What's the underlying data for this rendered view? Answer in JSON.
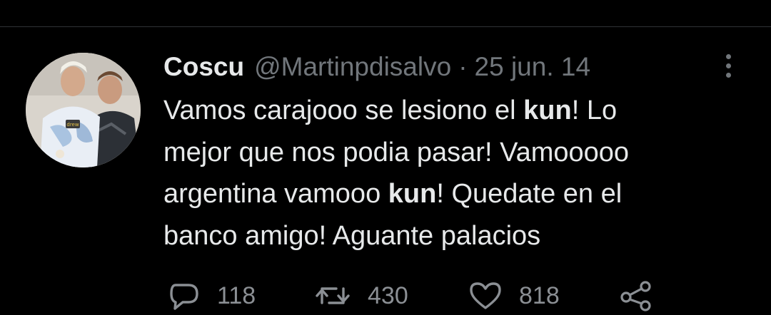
{
  "tweet": {
    "author_name": "Coscu",
    "handle": "@Martinpdisalvo",
    "separator": "·",
    "date": "25 jun. 14",
    "text_lines": [
      [
        {
          "t": "Vamos carajooo se lesiono el "
        },
        {
          "t": "kun",
          "b": true
        },
        {
          "t": "! Lo"
        }
      ],
      [
        {
          "t": "mejor que nos podia pasar! Vamooooo"
        }
      ],
      [
        {
          "t": "argentina vamooo "
        },
        {
          "t": "kun",
          "b": true
        },
        {
          "t": "! Quedate en el"
        }
      ],
      [
        {
          "t": "banco amigo! Aguante palacios"
        }
      ]
    ]
  },
  "actions": {
    "reply_count": "118",
    "retweet_count": "430",
    "like_count": "818"
  },
  "icons": {
    "reply": "reply-icon",
    "retweet": "retweet-icon",
    "like": "heart-icon",
    "share": "share-icon",
    "more": "more-options-icon"
  },
  "colors": {
    "background": "#000000",
    "text": "#e7e9ea",
    "secondary_text": "#71767b",
    "divider": "#2f3336"
  }
}
